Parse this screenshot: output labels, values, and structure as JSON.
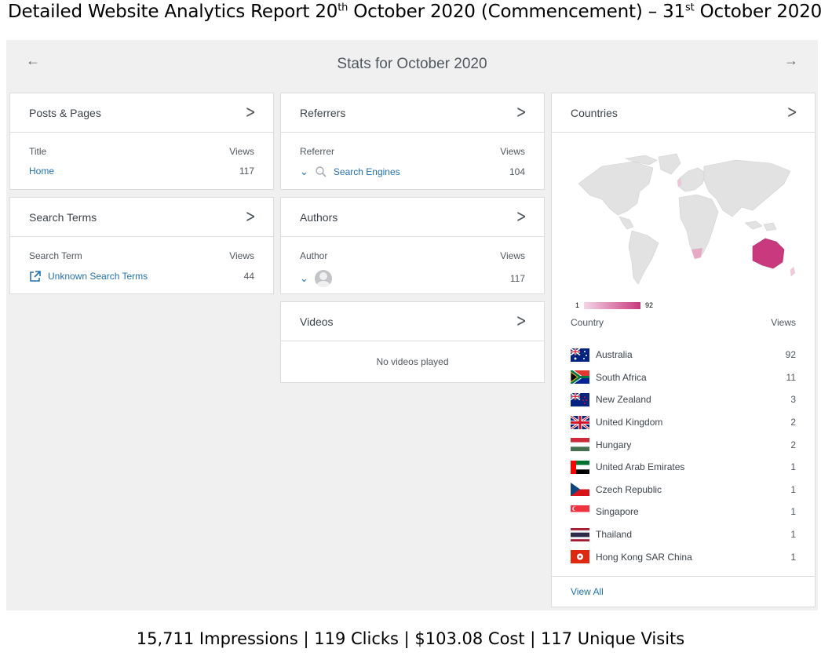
{
  "doc_title": {
    "prefix": "Detailed Website Analytics Report 20",
    "sup1": "th",
    "middle": " October 2020 (Commencement) – 31",
    "sup2": "st",
    "suffix": " October 2020"
  },
  "header": {
    "title": "Stats for October 2020",
    "prev_icon": "arrow-left-icon",
    "next_icon": "arrow-right-icon"
  },
  "posts": {
    "title": "Posts & Pages",
    "col1": "Title",
    "col2": "Views",
    "rows": [
      {
        "label": "Home",
        "views": "117"
      }
    ]
  },
  "referrers": {
    "title": "Referrers",
    "col1": "Referrer",
    "col2": "Views",
    "rows": [
      {
        "label": "Search Engines",
        "views": "104"
      }
    ]
  },
  "search_terms": {
    "title": "Search Terms",
    "col1": "Search Term",
    "col2": "Views",
    "rows": [
      {
        "label": "Unknown Search Terms",
        "views": "44"
      }
    ]
  },
  "authors": {
    "title": "Authors",
    "col1": "Author",
    "col2": "Views",
    "rows": [
      {
        "views": "117"
      }
    ]
  },
  "videos": {
    "title": "Videos",
    "empty": "No videos played"
  },
  "countries": {
    "title": "Countries",
    "legend_min": "1",
    "legend_max": "92",
    "col1": "Country",
    "col2": "Views",
    "highlight_color": "#c9397d",
    "rows": [
      {
        "name": "Australia",
        "views": "92"
      },
      {
        "name": "South Africa",
        "views": "11"
      },
      {
        "name": "New Zealand",
        "views": "3"
      },
      {
        "name": "United Kingdom",
        "views": "2"
      },
      {
        "name": "Hungary",
        "views": "2"
      },
      {
        "name": "United Arab Emirates",
        "views": "1"
      },
      {
        "name": "Czech Republic",
        "views": "1"
      },
      {
        "name": "Singapore",
        "views": "1"
      },
      {
        "name": "Thailand",
        "views": "1"
      },
      {
        "name": "Hong Kong SAR China",
        "views": "1"
      }
    ],
    "view_all": "View All"
  },
  "summary": "15,711 Impressions | 119 Clicks | $103.08 Cost | 117 Unique Visits",
  "colors": {
    "link": "#2271b1",
    "background": "#f0f0f1",
    "border": "#dcdcde"
  }
}
